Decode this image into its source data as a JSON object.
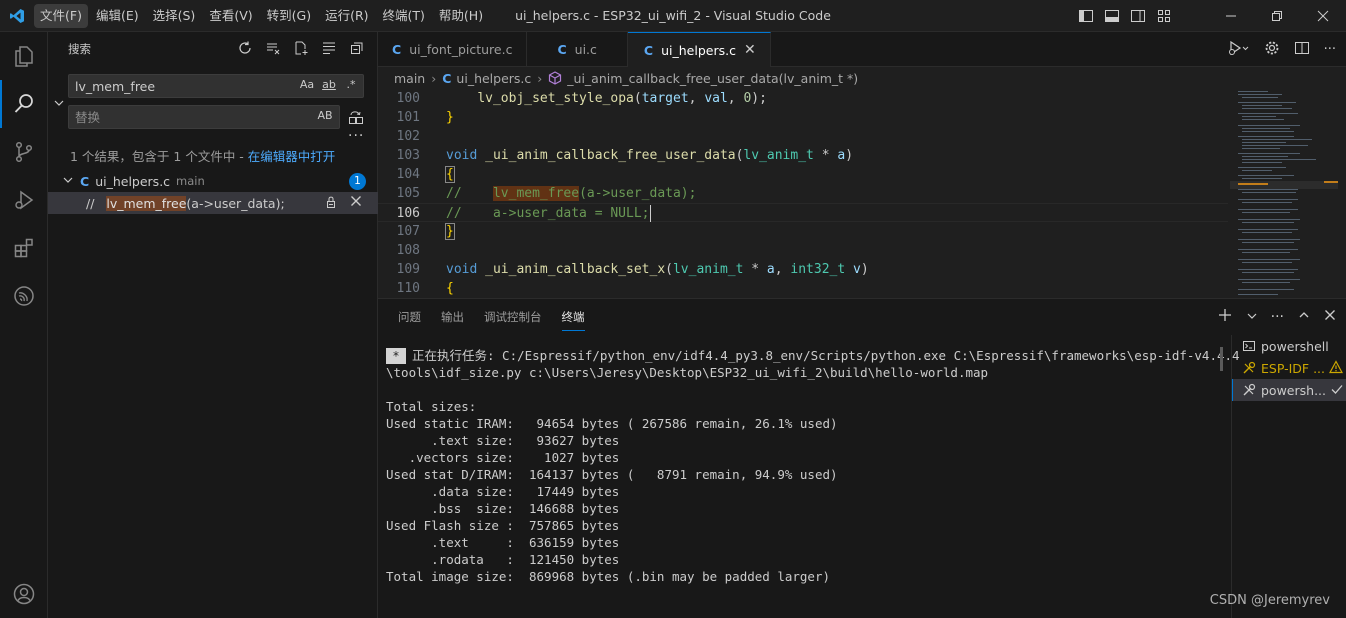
{
  "titlebar": {
    "menu": [
      "文件(F)",
      "编辑(E)",
      "选择(S)",
      "查看(V)",
      "转到(G)",
      "运行(R)",
      "终端(T)",
      "帮助(H)"
    ],
    "window_title": "ui_helpers.c - ESP32_ui_wifi_2 - Visual Studio Code"
  },
  "sidebar": {
    "title": "搜索",
    "search_value": "lv_mem_free",
    "match_case": "Aa",
    "whole_word": "ab",
    "regex": ".*",
    "replace_placeholder": "替换",
    "replace_all": "AB",
    "summary_text": "1 个结果，包含于 1 个文件中 - ",
    "summary_link": "在编辑器中打开",
    "result_file": {
      "name": "ui_helpers.c",
      "folder": "main",
      "count": "1"
    },
    "match": {
      "prefix": "//   ",
      "highlight": "lv_mem_free",
      "suffix": "(a->user_data);"
    }
  },
  "editor": {
    "tabs": [
      {
        "label": "ui_font_picture.c",
        "active": false
      },
      {
        "label": "ui.c",
        "active": false
      },
      {
        "label": "ui_helpers.c",
        "active": true
      }
    ],
    "breadcrumb": {
      "folder": "main",
      "file": "ui_helpers.c",
      "symbol": "_ui_anim_callback_free_user_data(lv_anim_t *)"
    },
    "lines": [
      "100",
      "101",
      "102",
      "103",
      "104",
      "105",
      "106",
      "107",
      "108",
      "109",
      "110"
    ],
    "code": {
      "l100_fn": "lv_obj_set_style_opa",
      "l100_p1": "(",
      "l100_var1": "target",
      "l100_p2": ", ",
      "l100_var2": "val",
      "l100_p3": ", ",
      "l100_num": "0",
      "l100_p4": ");",
      "l101": "}",
      "l103_kw": "void",
      "l103_fn": "_ui_anim_callback_free_user_data",
      "l103_p1": "(",
      "l103_ty": "lv_anim_t",
      "l103_p2": " * ",
      "l103_var": "a",
      "l103_p3": ")",
      "l104": "{",
      "l105_a": "//    ",
      "l105_hl": "lv_mem_free",
      "l105_b": "(a->user_data);",
      "l106": "//    a->user_data = NULL;",
      "l107": "}",
      "l109_kw": "void",
      "l109_fn": "_ui_anim_callback_set_x",
      "l109_p1": "(",
      "l109_ty1": "lv_anim_t",
      "l109_p2": " * ",
      "l109_var1": "a",
      "l109_p3": ", ",
      "l109_ty2": "int32_t",
      "l109_p4": " ",
      "l109_var2": "v",
      "l109_p5": ")",
      "l110": "{"
    }
  },
  "panel": {
    "tabs": [
      "问题",
      "输出",
      "调试控制台",
      "终端"
    ],
    "active_tab": "终端",
    "terminal": {
      "marker": "*",
      "line1": "正在执行任务: C:/Espressif/python_env/idf4.4_py3.8_env/Scripts/python.exe C:\\Espressif\\frameworks\\esp-idf-v4.4.4",
      "line2": "\\tools\\idf_size.py c:\\Users\\Jeresy\\Desktop\\ESP32_ui_wifi_2\\build\\hello-world.map",
      "output": "Total sizes:\nUsed static IRAM:   94654 bytes ( 267586 remain, 26.1% used)\n      .text size:   93627 bytes\n   .vectors size:    1027 bytes\nUsed stat D/IRAM:  164137 bytes (   8791 remain, 94.9% used)\n      .data size:   17449 bytes\n      .bss  size:  146688 bytes\nUsed Flash size :  757865 bytes\n      .text     :  636159 bytes\n      .rodata   :  121450 bytes\nTotal image size:  869968 bytes (.bin may be padded larger)"
    },
    "terminal_list": [
      {
        "label": "powershell",
        "state": "normal"
      },
      {
        "label": "ESP-IDF ...",
        "state": "warn"
      },
      {
        "label": "powersh...",
        "state": "active"
      }
    ]
  },
  "watermark": "CSDN @Jeremyrev"
}
